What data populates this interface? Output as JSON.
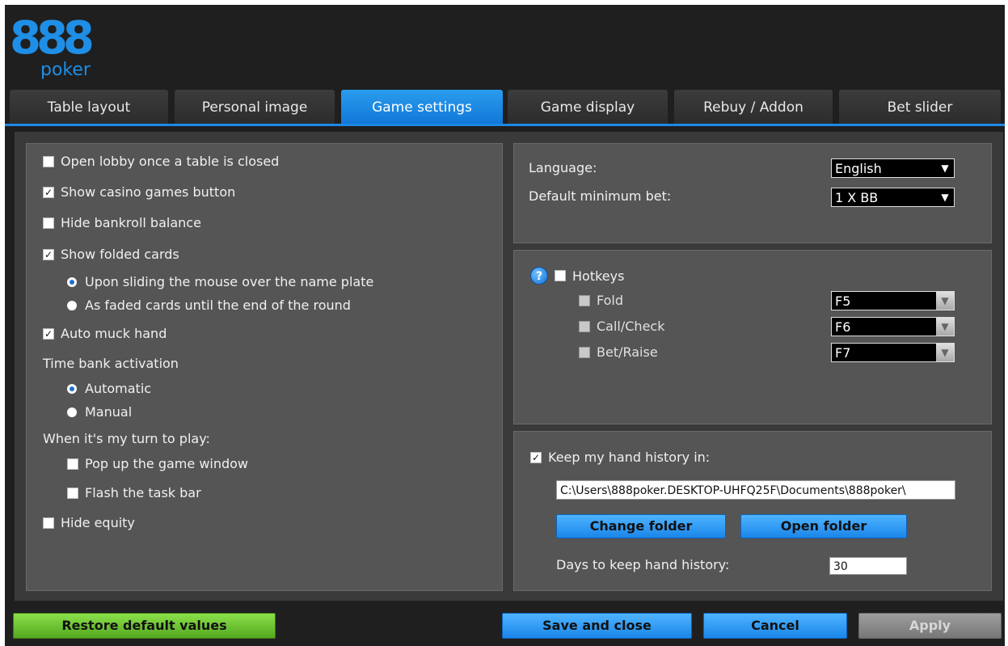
{
  "logo": {
    "digits": "888",
    "word": "poker"
  },
  "tabs": [
    {
      "label": "Table layout"
    },
    {
      "label": "Personal image"
    },
    {
      "label": "Game settings"
    },
    {
      "label": "Game display"
    },
    {
      "label": "Rebuy / Addon"
    },
    {
      "label": "Bet slider"
    }
  ],
  "active_tab": "Game settings",
  "left_panel": {
    "open_lobby": {
      "label": "Open lobby once a table is closed",
      "checked": false
    },
    "show_casino": {
      "label": "Show casino games button",
      "checked": true
    },
    "hide_bankroll": {
      "label": "Hide bankroll balance",
      "checked": false
    },
    "show_folded": {
      "label": "Show folded cards",
      "checked": true
    },
    "folded_opt_sliding": {
      "label": "Upon sliding the mouse over the name plate",
      "selected": true
    },
    "folded_opt_faded": {
      "label": "As faded cards until the end of the round",
      "selected": false
    },
    "auto_muck": {
      "label": "Auto muck hand",
      "checked": true
    },
    "time_bank_heading": "Time bank activation",
    "time_bank_automatic": {
      "label": "Automatic",
      "selected": true
    },
    "time_bank_manual": {
      "label": "Manual",
      "selected": false
    },
    "my_turn_heading": "When it's my turn to play:",
    "popup_game": {
      "label": "Pop up the game window",
      "checked": false
    },
    "flash_taskbar": {
      "label": "Flash the task bar",
      "checked": false
    },
    "hide_equity": {
      "label": "Hide equity",
      "checked": false
    }
  },
  "general": {
    "language_label": "Language:",
    "language_value": "English",
    "min_bet_label": "Default minimum bet:",
    "min_bet_value": "1 X BB"
  },
  "hotkeys": {
    "help_glyph": "?",
    "label": "Hotkeys",
    "enabled": false,
    "items": [
      {
        "label": "Fold",
        "key": "F5"
      },
      {
        "label": "Call/Check",
        "key": "F6"
      },
      {
        "label": "Bet/Raise",
        "key": "F7"
      }
    ]
  },
  "history": {
    "keep_label": "Keep my hand history in:",
    "keep_checked": true,
    "path": "C:\\Users\\888poker.DESKTOP-UHFQ25F\\Documents\\888poker\\",
    "change_folder": "Change folder",
    "open_folder": "Open folder",
    "days_label": "Days to keep hand history:",
    "days_value": "30"
  },
  "footer": {
    "restore": "Restore default values",
    "save_close": "Save and close",
    "cancel": "Cancel",
    "apply": "Apply"
  },
  "colors": {
    "accent_blue": "#1e88e5",
    "restore_green": "#5cb52a",
    "panel_gray": "#555555"
  }
}
